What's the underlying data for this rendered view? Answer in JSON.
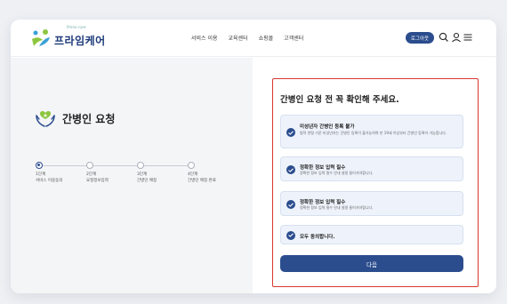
{
  "header": {
    "logo_small": "Prime care",
    "logo_text": "프라임케어",
    "nav": [
      "서비스 이용",
      "교육센터",
      "쇼핑몰",
      "고객센터"
    ],
    "login_label": "로그아웃"
  },
  "left": {
    "page_title": "간병인 요청",
    "steps": [
      {
        "num": "1단계",
        "name": "서비스 이용동의"
      },
      {
        "num": "2단계",
        "name": "요청정보입력"
      },
      {
        "num": "3단계",
        "name": "간병인 매칭"
      },
      {
        "num": "4단계",
        "name": "간병인 매칭 완료"
      }
    ]
  },
  "notice": {
    "title": "간병인 요청 전 꼭 확인해 주세요.",
    "cards": [
      {
        "title": "미성년자 간병인 등록 불가",
        "desc": "법적 연령 기준 미성년자는 간병인 등록이 불가능하며 만 19세 이상부터 간병인 등록이 가능합니다."
      },
      {
        "title": "정확한 정보 입력 필수",
        "desc": "정확한 정보 입력 필수 안내 설명 들어가야합니다."
      },
      {
        "title": "정확한 정보 입력 필수",
        "desc": "정확한 정보 입력 필수 안내 설명 들어가야합니다."
      },
      {
        "title": "모두 동의합니다.",
        "desc": ""
      }
    ],
    "next_label": "다음"
  },
  "colors": {
    "primary": "#2b4d8e",
    "highlight_border": "#d9362f",
    "card_bg": "#eef3fb",
    "logo_green": "#8cc63f"
  }
}
